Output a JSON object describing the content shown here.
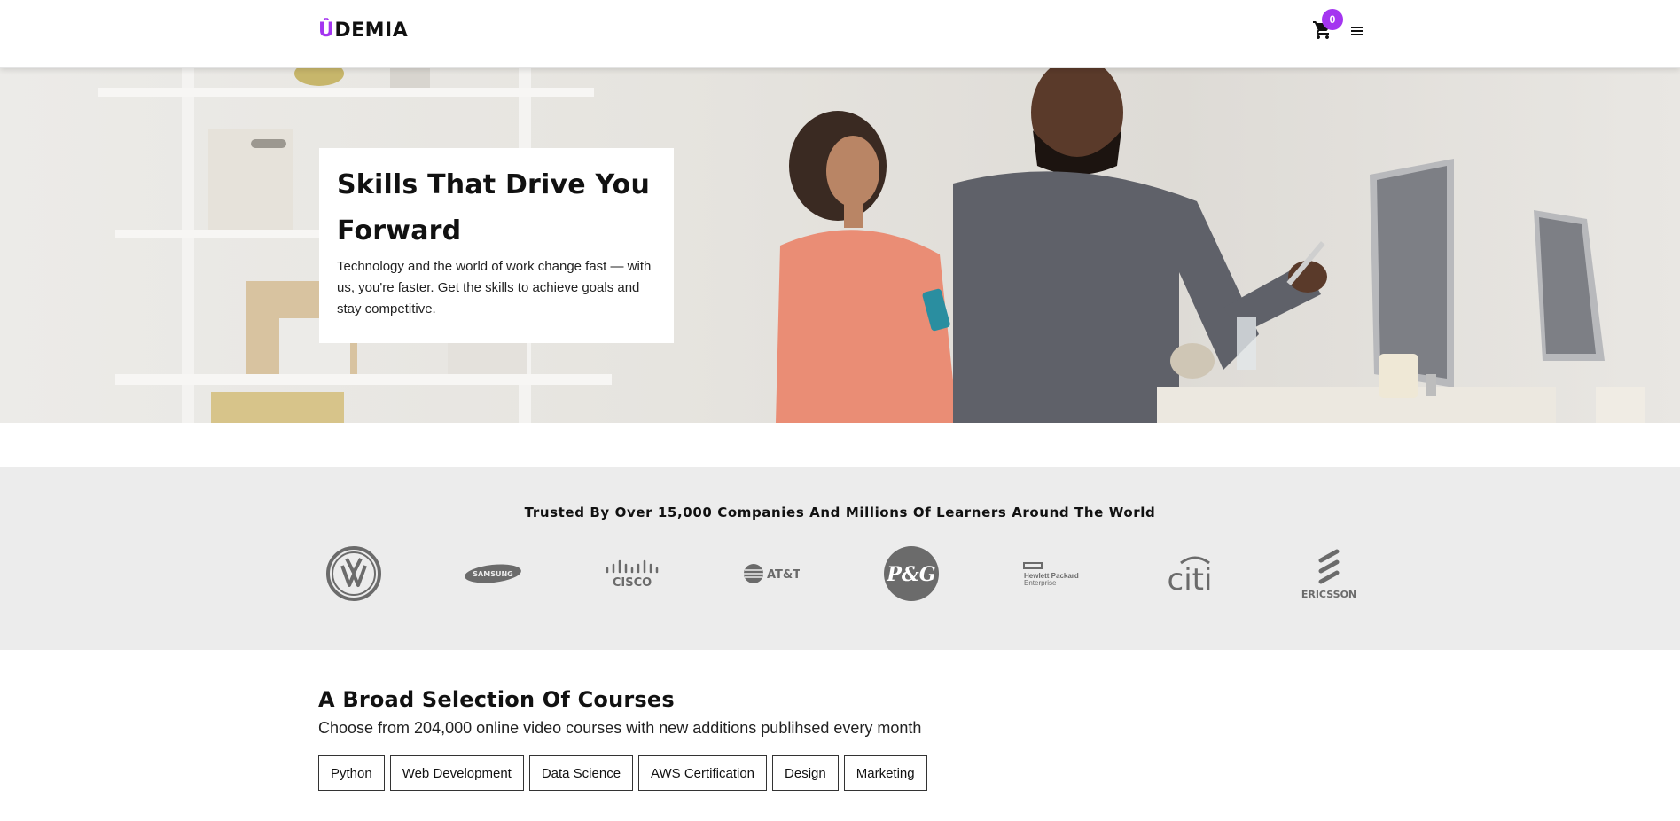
{
  "header": {
    "logo_accent": "Û",
    "logo_rest": "DEMIA",
    "cart_count": "0"
  },
  "hero": {
    "title": "Skills That Drive You Forward",
    "text": "Technology and the world of work change fast — with us, you're faster. Get the skills to achieve goals and stay competitive."
  },
  "trusted": {
    "title": "Trusted By Over 15,000 Companies And Millions Of Learners Around The World",
    "brands": [
      "Volkswagen",
      "SAMSUNG",
      "CISCO",
      "AT&T",
      "P&G",
      "Hewlett Packard Enterprise",
      "citi",
      "ERICSSON"
    ]
  },
  "courses": {
    "title": "A Broad Selection Of Courses",
    "subtitle": "Choose from 204,000 online video courses with new additions publihsed every month",
    "chips": [
      "Python",
      "Web Development",
      "Data Science",
      "AWS Certification",
      "Design",
      "Marketing"
    ]
  },
  "colors": {
    "accent": "#a435f0",
    "logo_gray": "#6b6b6b",
    "band_bg": "#ececec"
  }
}
